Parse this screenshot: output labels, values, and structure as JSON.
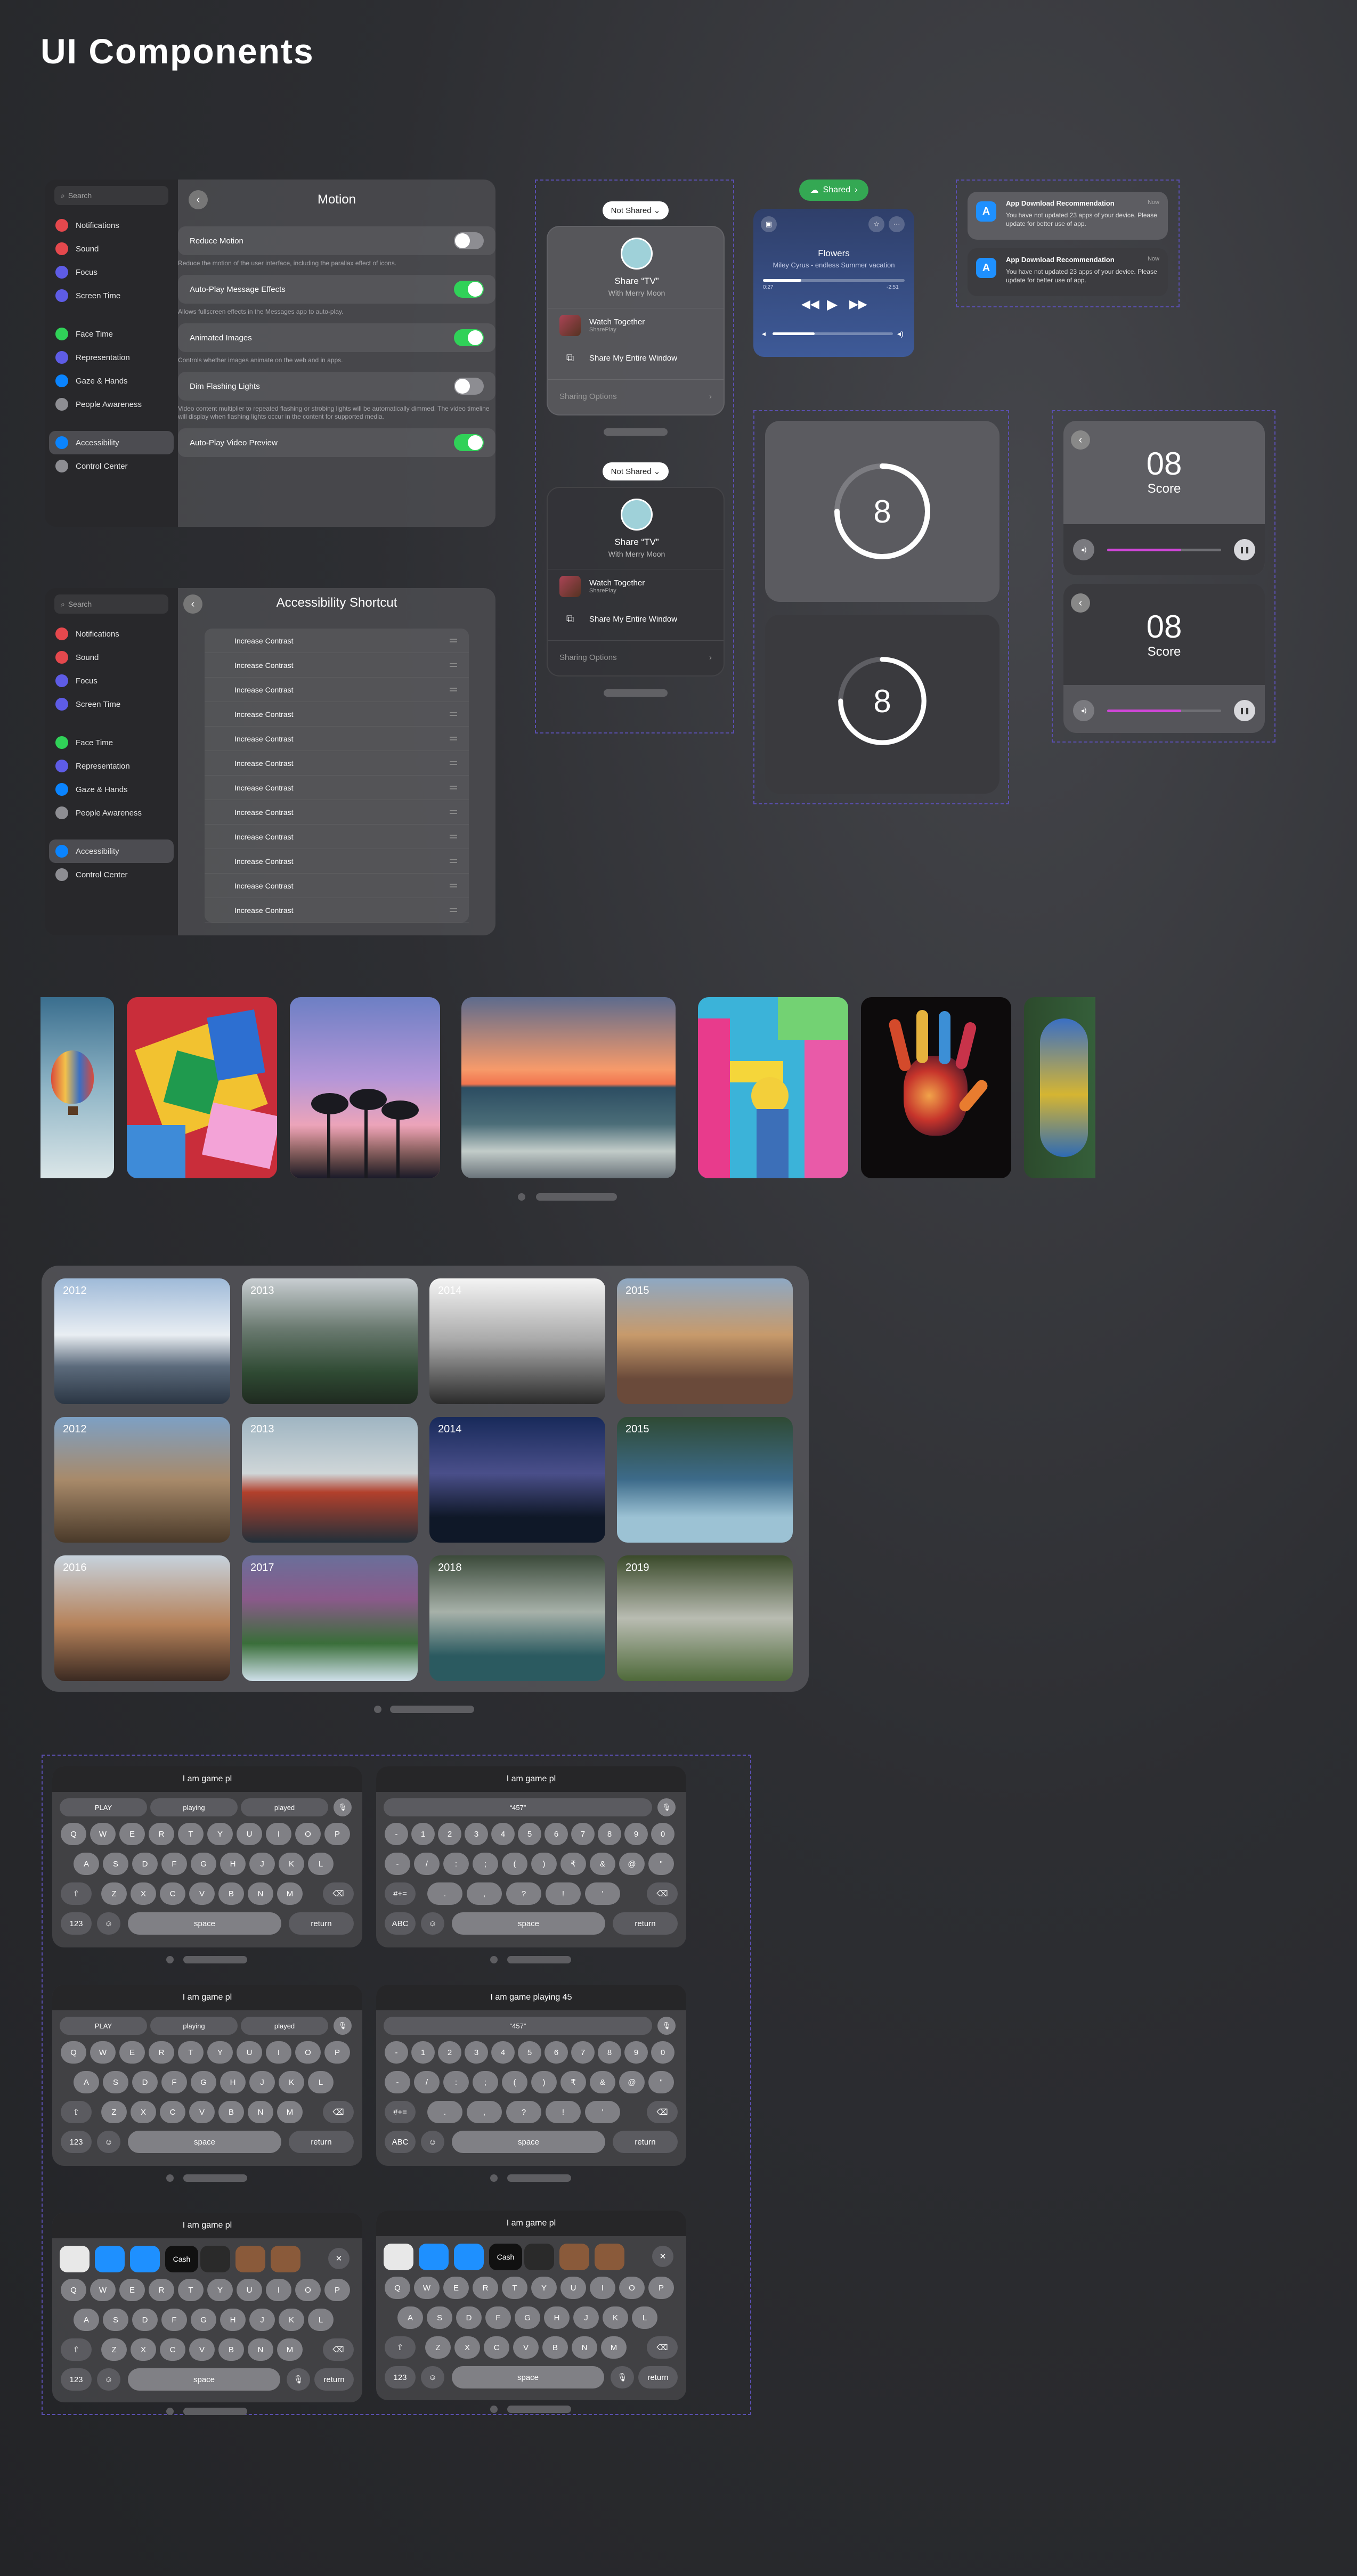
{
  "page_title": "UI Components",
  "sidebar": {
    "search": "Search",
    "items": [
      {
        "label": "Notifications",
        "icon": "bell-icon",
        "color": "#e5484d"
      },
      {
        "label": "Sound",
        "icon": "speaker-icon",
        "color": "#e5484d"
      },
      {
        "label": "Focus",
        "icon": "moon-icon",
        "color": "#5e5ce6"
      },
      {
        "label": "Screen Time",
        "icon": "hourglass-icon",
        "color": "#5e5ce6"
      },
      {
        "label": "Face Time",
        "icon": "video-icon",
        "color": "#30d158"
      },
      {
        "label": "Representation",
        "icon": "person-icon",
        "color": "#5e5ce6"
      },
      {
        "label": "Gaze & Hands",
        "icon": "hand-icon",
        "color": "#0a84ff"
      },
      {
        "label": "People Awareness",
        "icon": "people-icon",
        "color": "#8e8e93"
      },
      {
        "label": "Accessibility",
        "icon": "accessibility-icon",
        "color": "#0a84ff"
      },
      {
        "label": "Control Center",
        "icon": "switches-icon",
        "color": "#8e8e93"
      }
    ]
  },
  "motion": {
    "title": "Motion",
    "rows": [
      {
        "label": "Reduce Motion",
        "on": false,
        "desc": "Reduce the motion of the user interface, including the parallax effect of icons."
      },
      {
        "label": "Auto-Play Message Effects",
        "on": true,
        "desc": "Allows fullscreen effects in the Messages app to auto-play."
      },
      {
        "label": "Animated Images",
        "on": true,
        "desc": "Controls whether images animate on the web and in apps."
      },
      {
        "label": "Dim Flashing Lights",
        "on": false,
        "desc": "Video content multiplier to repeated flashing or strobing lights will be automatically dimmed. The video timeline will display when flashing lights occur in the content for supported media."
      },
      {
        "label": "Auto-Play Video Preview",
        "on": true,
        "desc": ""
      }
    ]
  },
  "shortcut": {
    "title": "Accessibility Shortcut",
    "items": [
      "Increase Contrast",
      "Increase Contrast",
      "Increase Contrast",
      "Increase Contrast",
      "Increase Contrast",
      "Increase Contrast",
      "Increase Contrast",
      "Increase Contrast",
      "Increase Contrast",
      "Increase Contrast",
      "Increase Contrast",
      "Increase Contrast"
    ]
  },
  "share": {
    "not_shared": "Not Shared",
    "title": "Share “TV”",
    "subtitle": "With Merry Moon",
    "watch": "Watch Together",
    "watch_sub": "SharePlay",
    "window": "Share My Entire Window",
    "options": "Sharing Options"
  },
  "player": {
    "shared": "Shared",
    "song": "Flowers",
    "artist": "Miley Cyrus - endless Summer vacation",
    "elapsed": "0:27",
    "remaining": "-2:51",
    "progress": 0.27,
    "volume": 0.35
  },
  "notifications": [
    {
      "title": "App Download Recommendation",
      "time": "Now",
      "body": "You have not updated 23 apps of your device. Please update for better use of app."
    },
    {
      "title": "App Download Recommendation",
      "time": "Now",
      "body": "You have not updated 23 apps of your device. Please update for better use of app."
    }
  ],
  "timers": [
    {
      "value": "8"
    },
    {
      "value": "8"
    }
  ],
  "scores": [
    {
      "value": "08",
      "label": "Score",
      "volume": 0.65
    },
    {
      "value": "08",
      "label": "Score",
      "volume": 0.65
    }
  ],
  "gallery_years": [
    "2012",
    "2013",
    "2014",
    "2015",
    "2012",
    "2013",
    "2014",
    "2015",
    "2016",
    "2017",
    "2018",
    "2019"
  ],
  "keyboards": [
    {
      "header": "I am game pl",
      "type": "alpha",
      "suggest": [
        "PLAY",
        "playing",
        "played"
      ]
    },
    {
      "header": "I am game pl",
      "type": "num",
      "suggest": [
        "“457”"
      ]
    },
    {
      "header": "I am game pl",
      "type": "alpha",
      "suggest": [
        "PLAY",
        "playing",
        "played"
      ]
    },
    {
      "header": "I am game playing 45",
      "type": "num",
      "suggest": [
        "“457”"
      ]
    },
    {
      "header": "I am game pl",
      "type": "emoji",
      "suggest": []
    },
    {
      "header": "I am game pl",
      "type": "emoji",
      "suggest": []
    }
  ],
  "kbd": {
    "row1": [
      "Q",
      "W",
      "E",
      "R",
      "T",
      "Y",
      "U",
      "I",
      "O",
      "P"
    ],
    "row2": [
      "A",
      "S",
      "D",
      "F",
      "G",
      "H",
      "J",
      "K",
      "L"
    ],
    "row3": [
      "Z",
      "X",
      "C",
      "V",
      "B",
      "N",
      "M"
    ],
    "nrow1": [
      "-",
      "1",
      "2",
      "3",
      "4",
      "5",
      "6",
      "7",
      "8",
      "9",
      "0"
    ],
    "nrow2": [
      "-",
      "/",
      ":",
      ";",
      "(",
      ")",
      "₹",
      "&",
      "@",
      "\""
    ],
    "nrow3": [
      ".",
      ",",
      "?",
      "!",
      "'"
    ],
    "shift_sym": "#+=",
    "k123": "123",
    "abc": "ABC",
    "space": "space",
    "ret": "return",
    "cash": "Cash"
  }
}
